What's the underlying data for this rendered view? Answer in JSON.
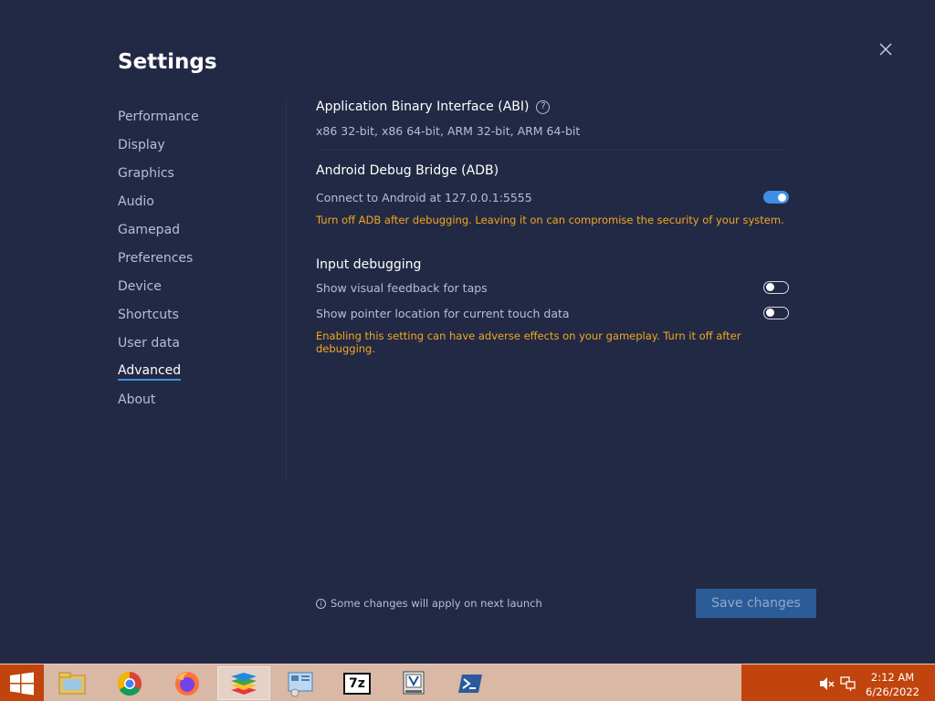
{
  "app": {
    "title": "Settings"
  },
  "sidebar": {
    "items": [
      {
        "label": "Performance"
      },
      {
        "label": "Display"
      },
      {
        "label": "Graphics"
      },
      {
        "label": "Audio"
      },
      {
        "label": "Gamepad"
      },
      {
        "label": "Preferences"
      },
      {
        "label": "Device"
      },
      {
        "label": "Shortcuts"
      },
      {
        "label": "User data"
      },
      {
        "label": "Advanced"
      },
      {
        "label": "About"
      }
    ],
    "active": "Advanced"
  },
  "abi": {
    "title": "Application Binary Interface (ABI)",
    "help_glyph": "?",
    "value": "x86 32-bit, x86 64-bit, ARM 32-bit, ARM 64-bit"
  },
  "adb": {
    "title": "Android Debug Bridge (ADB)",
    "connect_label": "Connect to Android at 127.0.0.1:5555",
    "connect_on": true,
    "warning": "Turn off ADB after debugging. Leaving it on can compromise the security of your system."
  },
  "input_debugging": {
    "title": "Input debugging",
    "visual_feedback_label": "Show visual feedback for taps",
    "visual_feedback_on": false,
    "pointer_location_label": "Show pointer location for current touch data",
    "pointer_location_on": false,
    "warning": "Enabling this setting can have adverse effects on your gameplay. Turn it off after debugging."
  },
  "footer": {
    "note": "Some changes will apply on next launch",
    "info_glyph": "i",
    "save_label": "Save changes"
  },
  "taskbar": {
    "time": "2:12 AM",
    "date": "6/26/2022",
    "apps": [
      "file-explorer-icon",
      "chrome-icon",
      "firefox-icon",
      "bluestacks-icon",
      "control-panel-icon",
      "7zip-icon",
      "vim-icon",
      "powershell-icon"
    ],
    "sevenzip_text": "7z"
  },
  "colors": {
    "background": "#222944",
    "accent": "#3e8ee6",
    "warning": "#f3a623",
    "taskbar": "#d9b8a6",
    "tray": "#c1440e"
  }
}
